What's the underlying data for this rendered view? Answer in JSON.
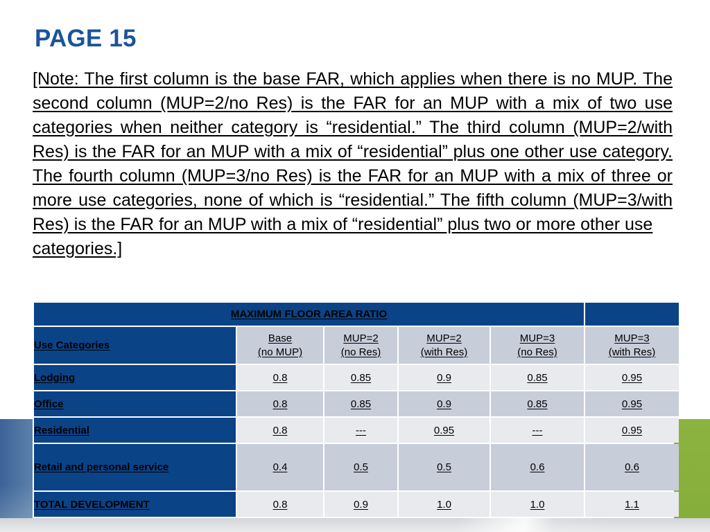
{
  "title": "PAGE 15",
  "note": {
    "text": "[Note:  The first column is the base FAR, which applies when there is no MUP.  The second column (MUP=2/no Res) is the FAR for an MUP with a mix of two use categories when neither category is “residential.”  The third column (MUP=2/with Res) is the FAR for an MUP with a mix of “residential” plus one other use category. The fourth column (MUP=3/no Res) is the FAR for an MUP with a mix of three or more use categories, none of which is “residential.” The fifth column (MUP=3/with Res) is the FAR for an MUP with a mix of “residential” plus two or more other use"
  },
  "note_last_line": "categories.]",
  "table": {
    "banner": "MAXIMUM FLOOR AREA RATIO",
    "banner_spare": "",
    "corner_label": "Use Categories",
    "columns": [
      {
        "line1": "Base ",
        "line2": "(no MUP)"
      },
      {
        "line1": "MUP=2",
        "line2": "(no Res)"
      },
      {
        "line1": "MUP=2",
        "line2": "(with Res)"
      },
      {
        "line1": "MUP=3",
        "line2": "(no Res)"
      },
      {
        "line1": "MUP=3",
        "line2": "(with Res)"
      }
    ],
    "rows": [
      {
        "label": "Lodging",
        "values": [
          "0.8",
          "0.85",
          "0.9",
          "0.85",
          "0.95"
        ]
      },
      {
        "label": "Office",
        "values": [
          "0.8",
          "0.85",
          "0.9",
          "0.85",
          "0.95"
        ]
      },
      {
        "label": "Residential",
        "values": [
          "0.8 ",
          "---",
          "0.95",
          "---",
          "0.95"
        ]
      },
      {
        "label": "Retail and personal service",
        "values": [
          "0.4",
          "0.5",
          "0.5",
          "0.6",
          "0.6"
        ]
      },
      {
        "label": "TOTAL DEVELOPMENT",
        "values": [
          "0.8",
          "0.9",
          "1.0",
          "1.0",
          "1.1"
        ]
      }
    ]
  },
  "colors": {
    "header_blue": "#0b4387",
    "title_blue": "#1b5499",
    "row_light": "#e8eaee",
    "row_dark": "#c8cdda",
    "accent_green": "#8cb33f",
    "accent_slate_blue": "#4a719f"
  }
}
